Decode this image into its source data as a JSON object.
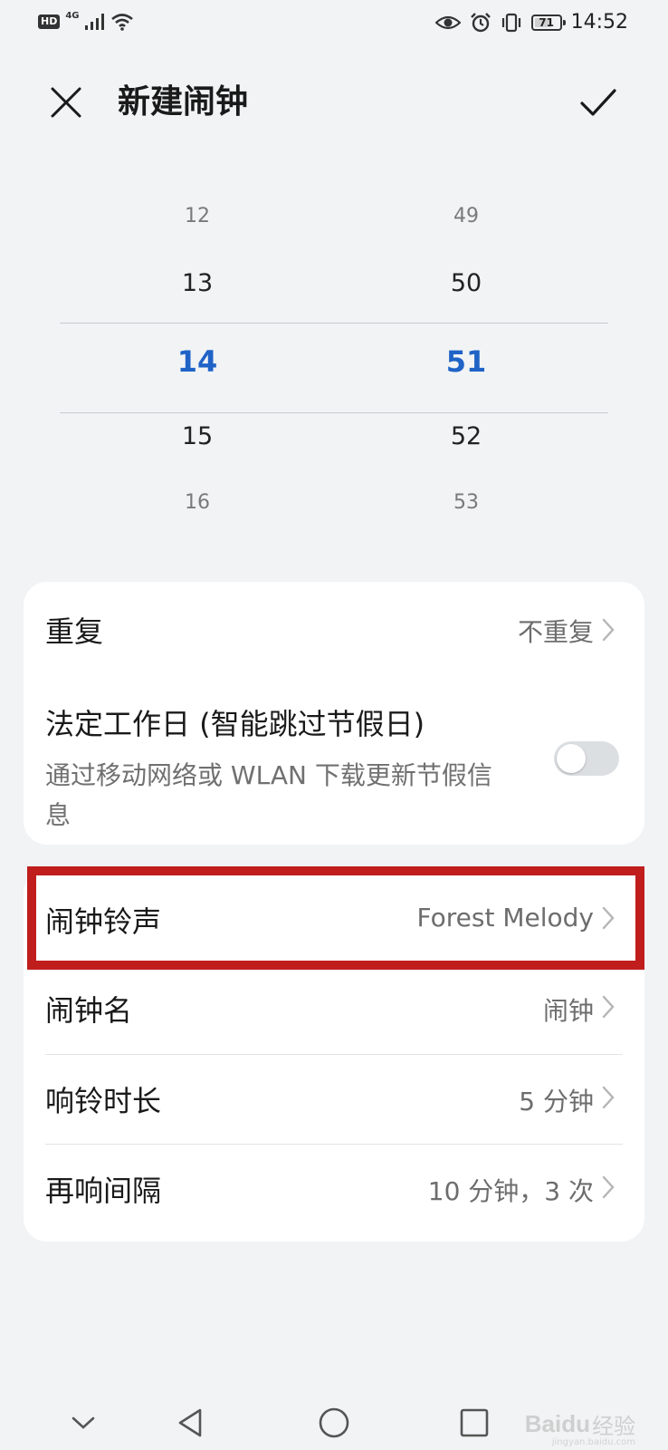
{
  "status_bar": {
    "hd": "HD",
    "network": "4G",
    "battery": "71",
    "battery_level": 0.71,
    "time": "14:52"
  },
  "header": {
    "title": "新建闹钟"
  },
  "picker": {
    "hours": [
      "12",
      "13",
      "14",
      "15",
      "16"
    ],
    "minutes": [
      "49",
      "50",
      "51",
      "52",
      "53"
    ],
    "selected_hour": "14",
    "selected_minute": "51"
  },
  "settings_card": {
    "repeat_label": "重复",
    "repeat_value": "不重复",
    "workday_label": "法定工作日 (智能跳过节假日)",
    "workday_desc": "通过移动网络或 WLAN 下载更新节假信息",
    "workday_enabled": false
  },
  "alarm_card": {
    "ringtone_label": "闹钟铃声",
    "ringtone_value": "Forest Melody",
    "name_label": "闹钟名",
    "name_value": "闹钟",
    "duration_label": "响铃时长",
    "duration_value": "5 分钟",
    "snooze_label": "再响间隔",
    "snooze_value": "10 分钟，3 次"
  },
  "watermark": {
    "brand": "Baidu",
    "suffix": "经验",
    "url": "jingyan.baidu.com"
  },
  "colors": {
    "accent": "#1f63c7",
    "highlight": "#c01d1d",
    "background": "#f1f3f5"
  }
}
